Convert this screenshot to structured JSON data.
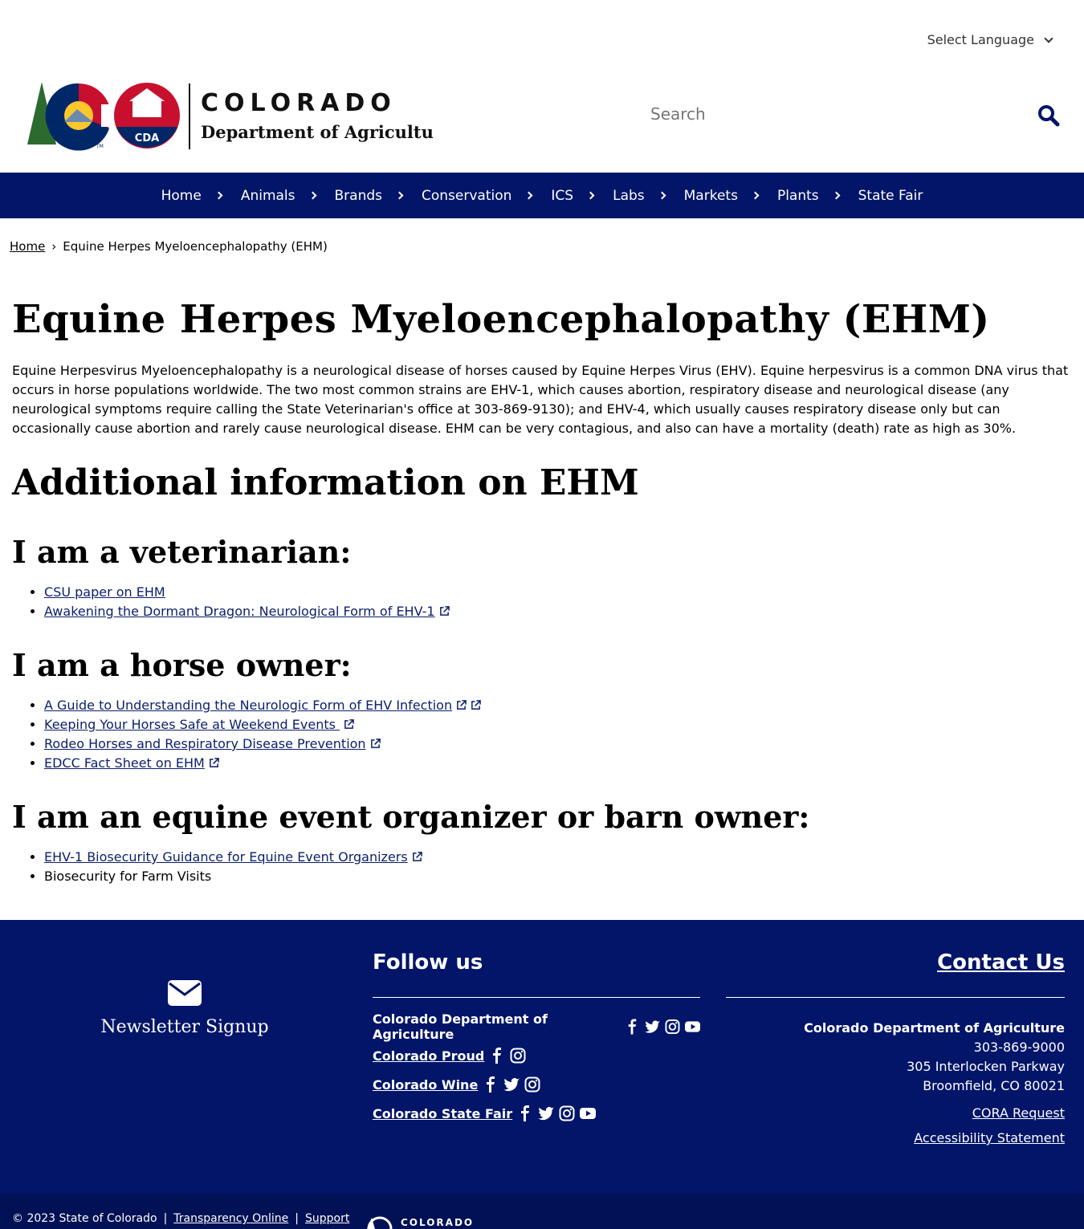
{
  "language": {
    "label": "Select Language"
  },
  "logo": {
    "state": "COLORADO",
    "dept": "Department of Agriculture",
    "badge": "CDA",
    "tm": "TM"
  },
  "search": {
    "placeholder": "Search"
  },
  "nav": [
    "Home",
    "Animals",
    "Brands",
    "Conservation",
    "ICS",
    "Labs",
    "Markets",
    "Plants",
    "State Fair"
  ],
  "breadcrumb": {
    "home": "Home",
    "current": "Equine Herpes Myeloencephalopathy (EHM)"
  },
  "main": {
    "title": "Equine Herpes Myeloencephalopathy (EHM)",
    "intro": "Equine Herpesvirus Myeloencephalopathy is a neurological disease of horses caused by Equine Herpes Virus (EHV). Equine herpesvirus is a common DNA virus that occurs in horse populations worldwide. The two most common strains are EHV-1, which causes abortion, respiratory disease and neurological disease (any neurological symptoms require calling the State Veterinarian's office at 303-869-9130); and EHV-4, which usually causes respiratory disease only but can occasionally cause abortion and rarely cause neurological disease. EHM can be very contagious, and also can have a mortality (death) rate as high as 30%.",
    "section_title": "Additional information on EHM",
    "vet": {
      "heading": "I am a veterinarian:",
      "links": [
        "CSU paper on EHM",
        "Awakening the Dormant Dragon: Neurological Form of EHV-1"
      ]
    },
    "owner": {
      "heading": "I am a horse owner:",
      "links": [
        "A Guide to Understanding the Neurologic Form of EHV Infection",
        "Keeping Your Horses Safe at Weekend Events ",
        "Rodeo Horses and Respiratory Disease Prevention",
        "EDCC Fact Sheet on EHM"
      ]
    },
    "organizer": {
      "heading": "I am an equine event organizer or barn owner:",
      "links": [
        "EHV-1 Biosecurity Guidance for Equine Event Organizers"
      ],
      "text": "Biosecurity for Farm Visits"
    }
  },
  "footer": {
    "newsletter": "Newsletter Signup",
    "follow_title": "Follow us",
    "social": [
      "Colorado Department of Agriculture",
      "Colorado Proud",
      "Colorado Wine",
      "Colorado State Fair"
    ],
    "contact_title": "Contact Us",
    "org": "Colorado Department of Agriculture",
    "phone": "303-869-9000",
    "street": "305 Interlocken Parkway",
    "city": "Broomfield, CO 80021",
    "cora": "CORA Request",
    "access": "Accessibility Statement",
    "copyright": "© 2023 State of Colorado",
    "sep": "|",
    "transparency": "Transparency Online",
    "support": "Support",
    "bottom_logo": "COLORADO"
  },
  "colors": {
    "navy": "#021569",
    "link": "#0b1f6b",
    "red": "#c8102e",
    "gold": "#ffc72c",
    "green": "#2d6a2f"
  }
}
